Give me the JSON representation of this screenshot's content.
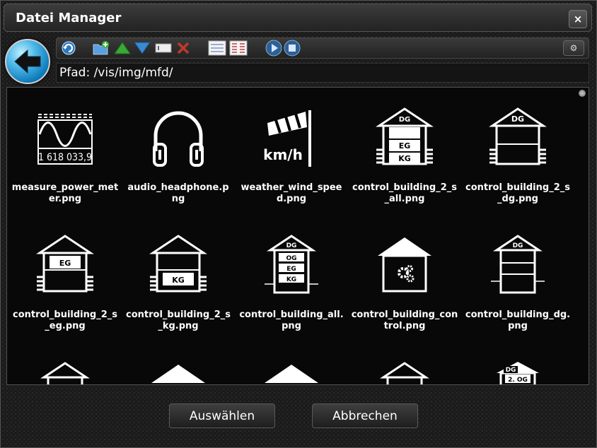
{
  "dialog": {
    "title": "Datei Manager",
    "close_label": "×"
  },
  "toolbar": {
    "buttons": [
      {
        "name": "refresh-button",
        "icon": "refresh-icon"
      },
      {
        "name": "new-folder-button",
        "icon": "folder-add-icon"
      },
      {
        "name": "upload-button",
        "icon": "arrow-up-icon"
      },
      {
        "name": "download-button",
        "icon": "arrow-down-icon"
      },
      {
        "name": "rename-button",
        "icon": "rename-icon"
      },
      {
        "name": "delete-button",
        "icon": "delete-icon"
      },
      {
        "name": "list-view-button",
        "icon": "list-view-icon"
      },
      {
        "name": "details-view-button",
        "icon": "details-view-icon"
      },
      {
        "name": "play-button",
        "icon": "play-icon"
      },
      {
        "name": "stop-button",
        "icon": "stop-icon"
      }
    ],
    "settings_label": "⚙"
  },
  "path": {
    "label": "Pfad: /vis/img/mfd/"
  },
  "files": [
    {
      "name": "measure_power_meter.png",
      "icon": "power-meter-icon"
    },
    {
      "name": "audio_headphone.png",
      "icon": "headphone-icon"
    },
    {
      "name": "weather_wind_speed.png",
      "icon": "wind-speed-icon"
    },
    {
      "name": "control_building_2_s_all.png",
      "icon": "building-2s-all-icon"
    },
    {
      "name": "control_building_2_s_dg.png",
      "icon": "building-2s-dg-icon"
    },
    {
      "name": "control_building_2_s_eg.png",
      "icon": "building-2s-eg-icon"
    },
    {
      "name": "control_building_2_s_kg.png",
      "icon": "building-2s-kg-icon"
    },
    {
      "name": "control_building_all.png",
      "icon": "building-all-icon"
    },
    {
      "name": "control_building_control.png",
      "icon": "building-control-icon"
    },
    {
      "name": "control_building_dg.png",
      "icon": "building-dg-icon"
    },
    {
      "name": "",
      "icon": "building-partial-icon"
    },
    {
      "name": "",
      "icon": "roof-partial-icon"
    },
    {
      "name": "",
      "icon": "roof-partial-icon"
    },
    {
      "name": "",
      "icon": "building-partial-icon"
    },
    {
      "name": "",
      "icon": "building-partial-dg2og-icon"
    }
  ],
  "partial_labels": {
    "dg": "DG",
    "og2": "2. OG"
  },
  "floor_labels": {
    "dg": "DG",
    "og": "OG",
    "eg": "EG",
    "kg": "KG"
  },
  "meter_reading": "1 618 033,9",
  "wind_unit": "km/h",
  "actions": {
    "select_label": "Auswählen",
    "cancel_label": "Abbrechen"
  }
}
